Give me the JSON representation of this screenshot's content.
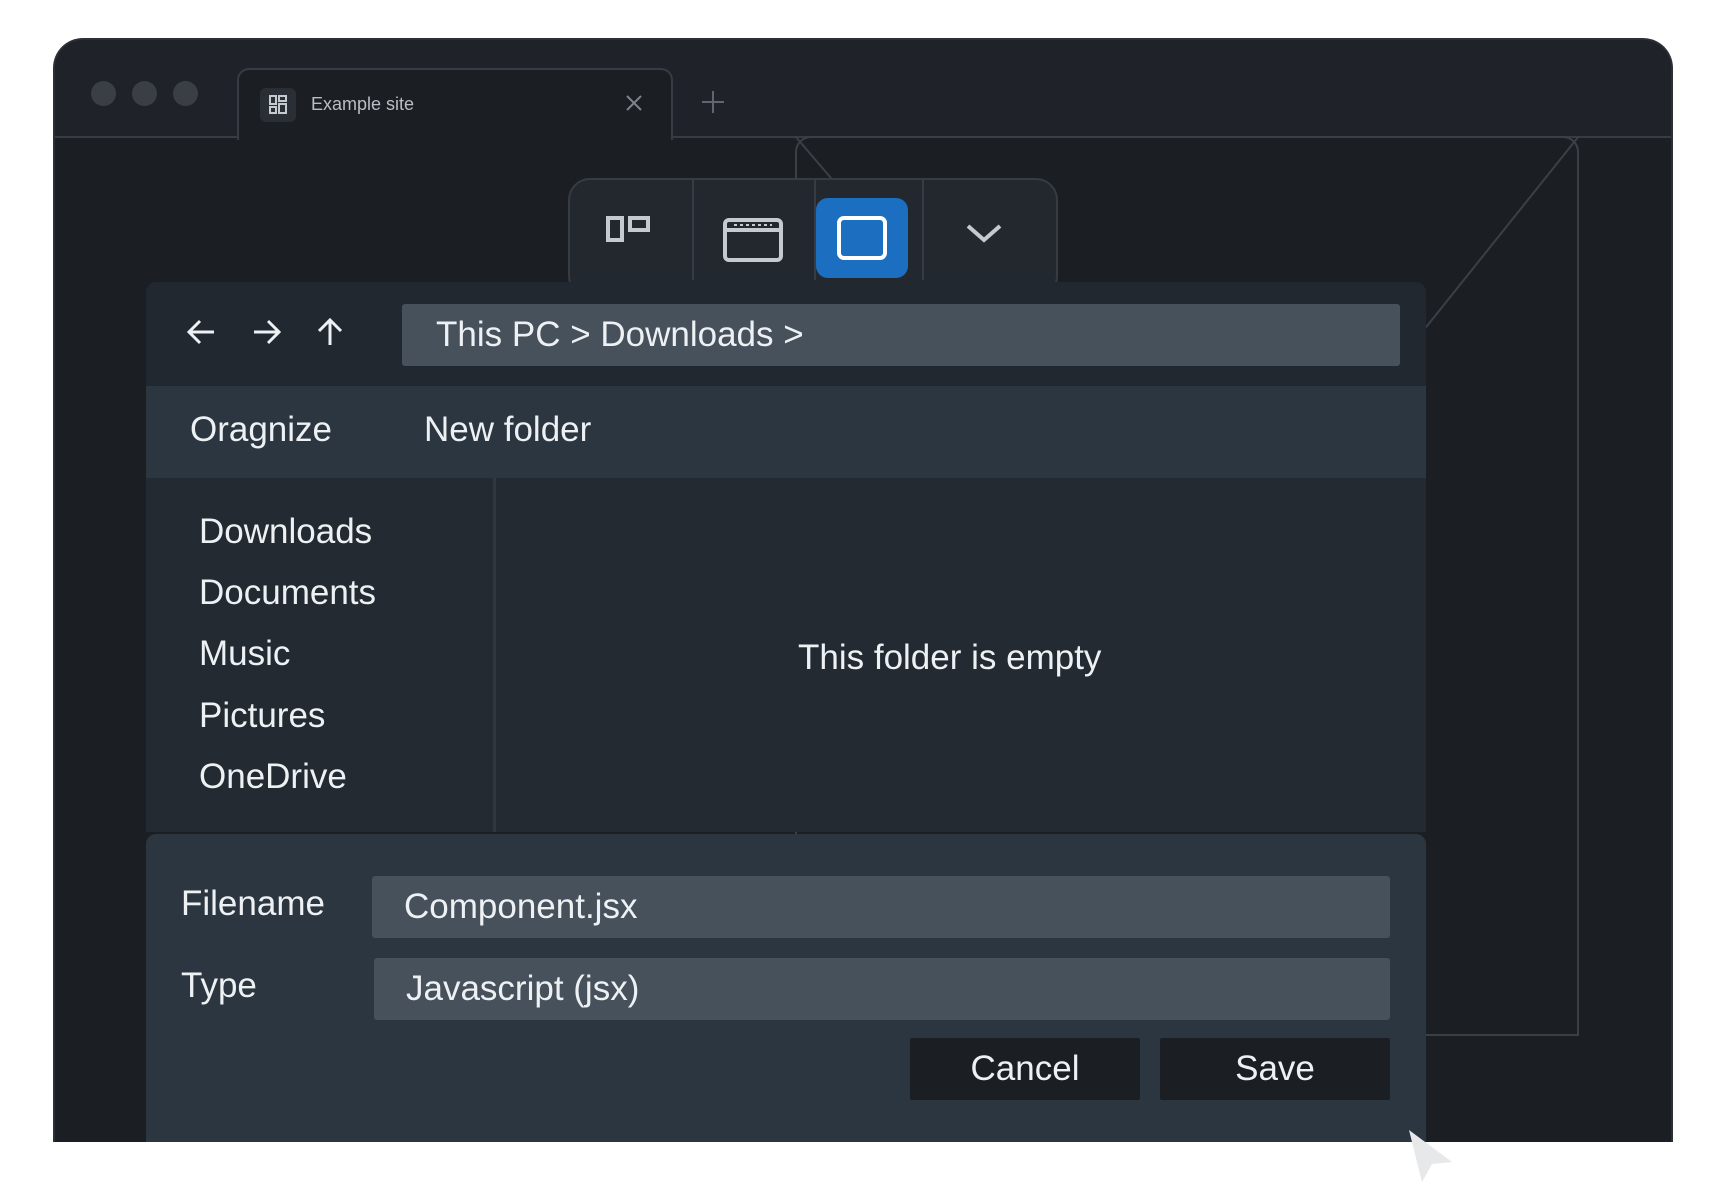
{
  "browser": {
    "tab": {
      "title": "Example site",
      "icon": "grid-icon",
      "close_icon": "close-icon"
    },
    "new_tab_icon": "plus-icon"
  },
  "toolbar_icons": [
    "layout-icon",
    "window-icon",
    "monitor-icon",
    "chevron-down-icon"
  ],
  "dialog": {
    "nav": {
      "back_icon": "arrow-left-icon",
      "forward_icon": "arrow-right-icon",
      "up_icon": "arrow-up-icon",
      "address": "This PC > Downloads >"
    },
    "menu": {
      "organize": "Oragnize",
      "new_folder": "New folder"
    },
    "sidebar": {
      "items": [
        {
          "label": "Downloads"
        },
        {
          "label": "Documents"
        },
        {
          "label": "Music"
        },
        {
          "label": "Pictures"
        },
        {
          "label": "OneDrive"
        }
      ]
    },
    "main": {
      "empty_message": "This folder is empty"
    },
    "footer": {
      "filename_label": "Filename",
      "filename_value": "Component.jsx",
      "type_label": "Type",
      "type_value": "Javascript (jsx)",
      "cancel_label": "Cancel",
      "save_label": "Save"
    }
  },
  "colors": {
    "accent": "#1c6ec0",
    "window_bg": "#1b1f24",
    "dialog_bar": "#2c3640",
    "input_bg": "#47515b",
    "text": "#eef1f4"
  }
}
